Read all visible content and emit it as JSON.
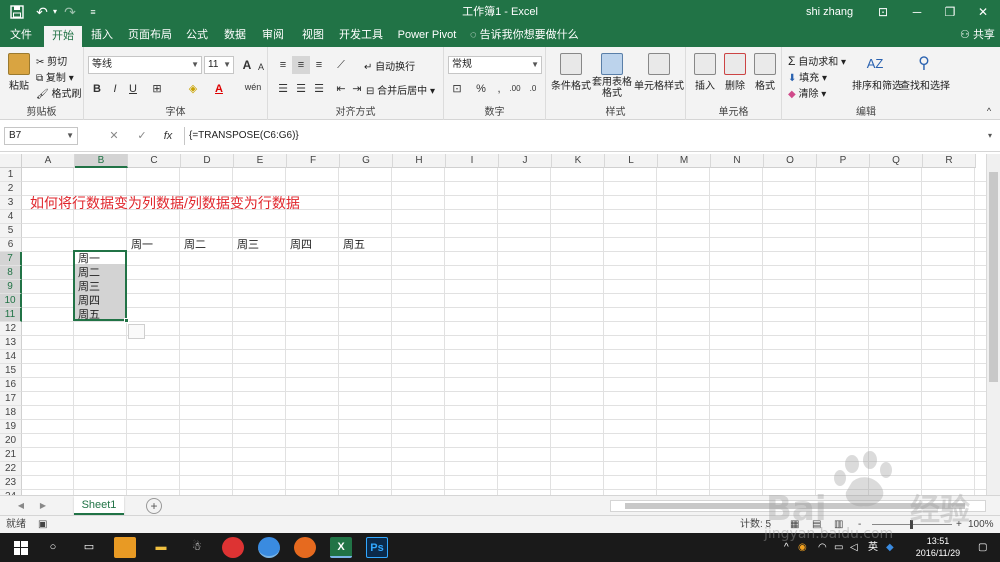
{
  "titlebar": {
    "title": "工作簿1 - Excel",
    "user": "shi zhang",
    "save_icon": "save-icon",
    "undo_glyph": "↶",
    "redo_glyph": "↷",
    "min": "─",
    "restore": "❐",
    "close": "✕",
    "ribbon_display": "⊡"
  },
  "tabs": [
    "文件",
    "开始",
    "插入",
    "页面布局",
    "公式",
    "数据",
    "审阅",
    "视图",
    "开发工具",
    "Power Pivot"
  ],
  "active_tab": "开始",
  "tellme": "告诉我你想要做什么",
  "share": "共享",
  "ribbon": {
    "clipboard": {
      "paste": "粘贴",
      "cut": "剪切",
      "copy": "复制",
      "format_painter": "格式刷",
      "label": "剪贴板"
    },
    "font": {
      "name": "等线",
      "size": "11",
      "label": "字体",
      "bold": "B",
      "italic": "I",
      "underline": "U",
      "grow": "A",
      "shrink": "A",
      "phonetic": "wén"
    },
    "alignment": {
      "wrap": "自动换行",
      "merge": "合并后居中",
      "label": "对齐方式"
    },
    "number": {
      "format": "常规",
      "percent": "%",
      "comma": ",",
      "inc": ".00",
      "dec": ".0",
      "label": "数字"
    },
    "styles": {
      "conditional": "条件格式",
      "table": "套用表格格式",
      "cell": "单元格样式",
      "label": "样式"
    },
    "cells": {
      "insert": "插入",
      "delete": "删除",
      "format": "格式",
      "label": "单元格"
    },
    "editing": {
      "autosum": "自动求和",
      "fill": "填充",
      "clear": "清除",
      "sort": "排序和筛选",
      "find": "查找和选择",
      "label": "编辑"
    }
  },
  "formula_bar": {
    "name_box": "B7",
    "cancel": "✕",
    "enter": "✓",
    "fx": "fx",
    "formula": "{=TRANSPOSE(C6:G6)}"
  },
  "grid": {
    "columns": [
      "A",
      "B",
      "C",
      "D",
      "E",
      "F",
      "G",
      "H",
      "I",
      "J",
      "K",
      "L",
      "M",
      "N",
      "O",
      "P",
      "Q",
      "R"
    ],
    "rows": [
      "1",
      "2",
      "3",
      "4",
      "5",
      "6",
      "7",
      "8",
      "9",
      "10",
      "11",
      "12",
      "13",
      "14",
      "15",
      "16",
      "17",
      "18",
      "19",
      "20",
      "21",
      "22",
      "23",
      "24"
    ],
    "title_text": "如何将行数据变为列数据/列数据变为行数据",
    "row6": [
      "周一",
      "周二",
      "周三",
      "周四",
      "周五"
    ],
    "colB": [
      "周一",
      "周二",
      "周三",
      "周四",
      "周五"
    ]
  },
  "sheet": {
    "tab": "Sheet1",
    "add": "+"
  },
  "status": {
    "ready": "就绪",
    "count": "计数: 5",
    "zoom": "100%",
    "zoom_minus": "-",
    "zoom_plus": "+"
  },
  "taskbar": {
    "clock_time": "13:51",
    "clock_date": "2016/11/29",
    "ime": "英",
    "ps": "Ps",
    "excel": "X"
  },
  "colors": {
    "excel_green": "#217346",
    "title_red": "#e0262c"
  }
}
